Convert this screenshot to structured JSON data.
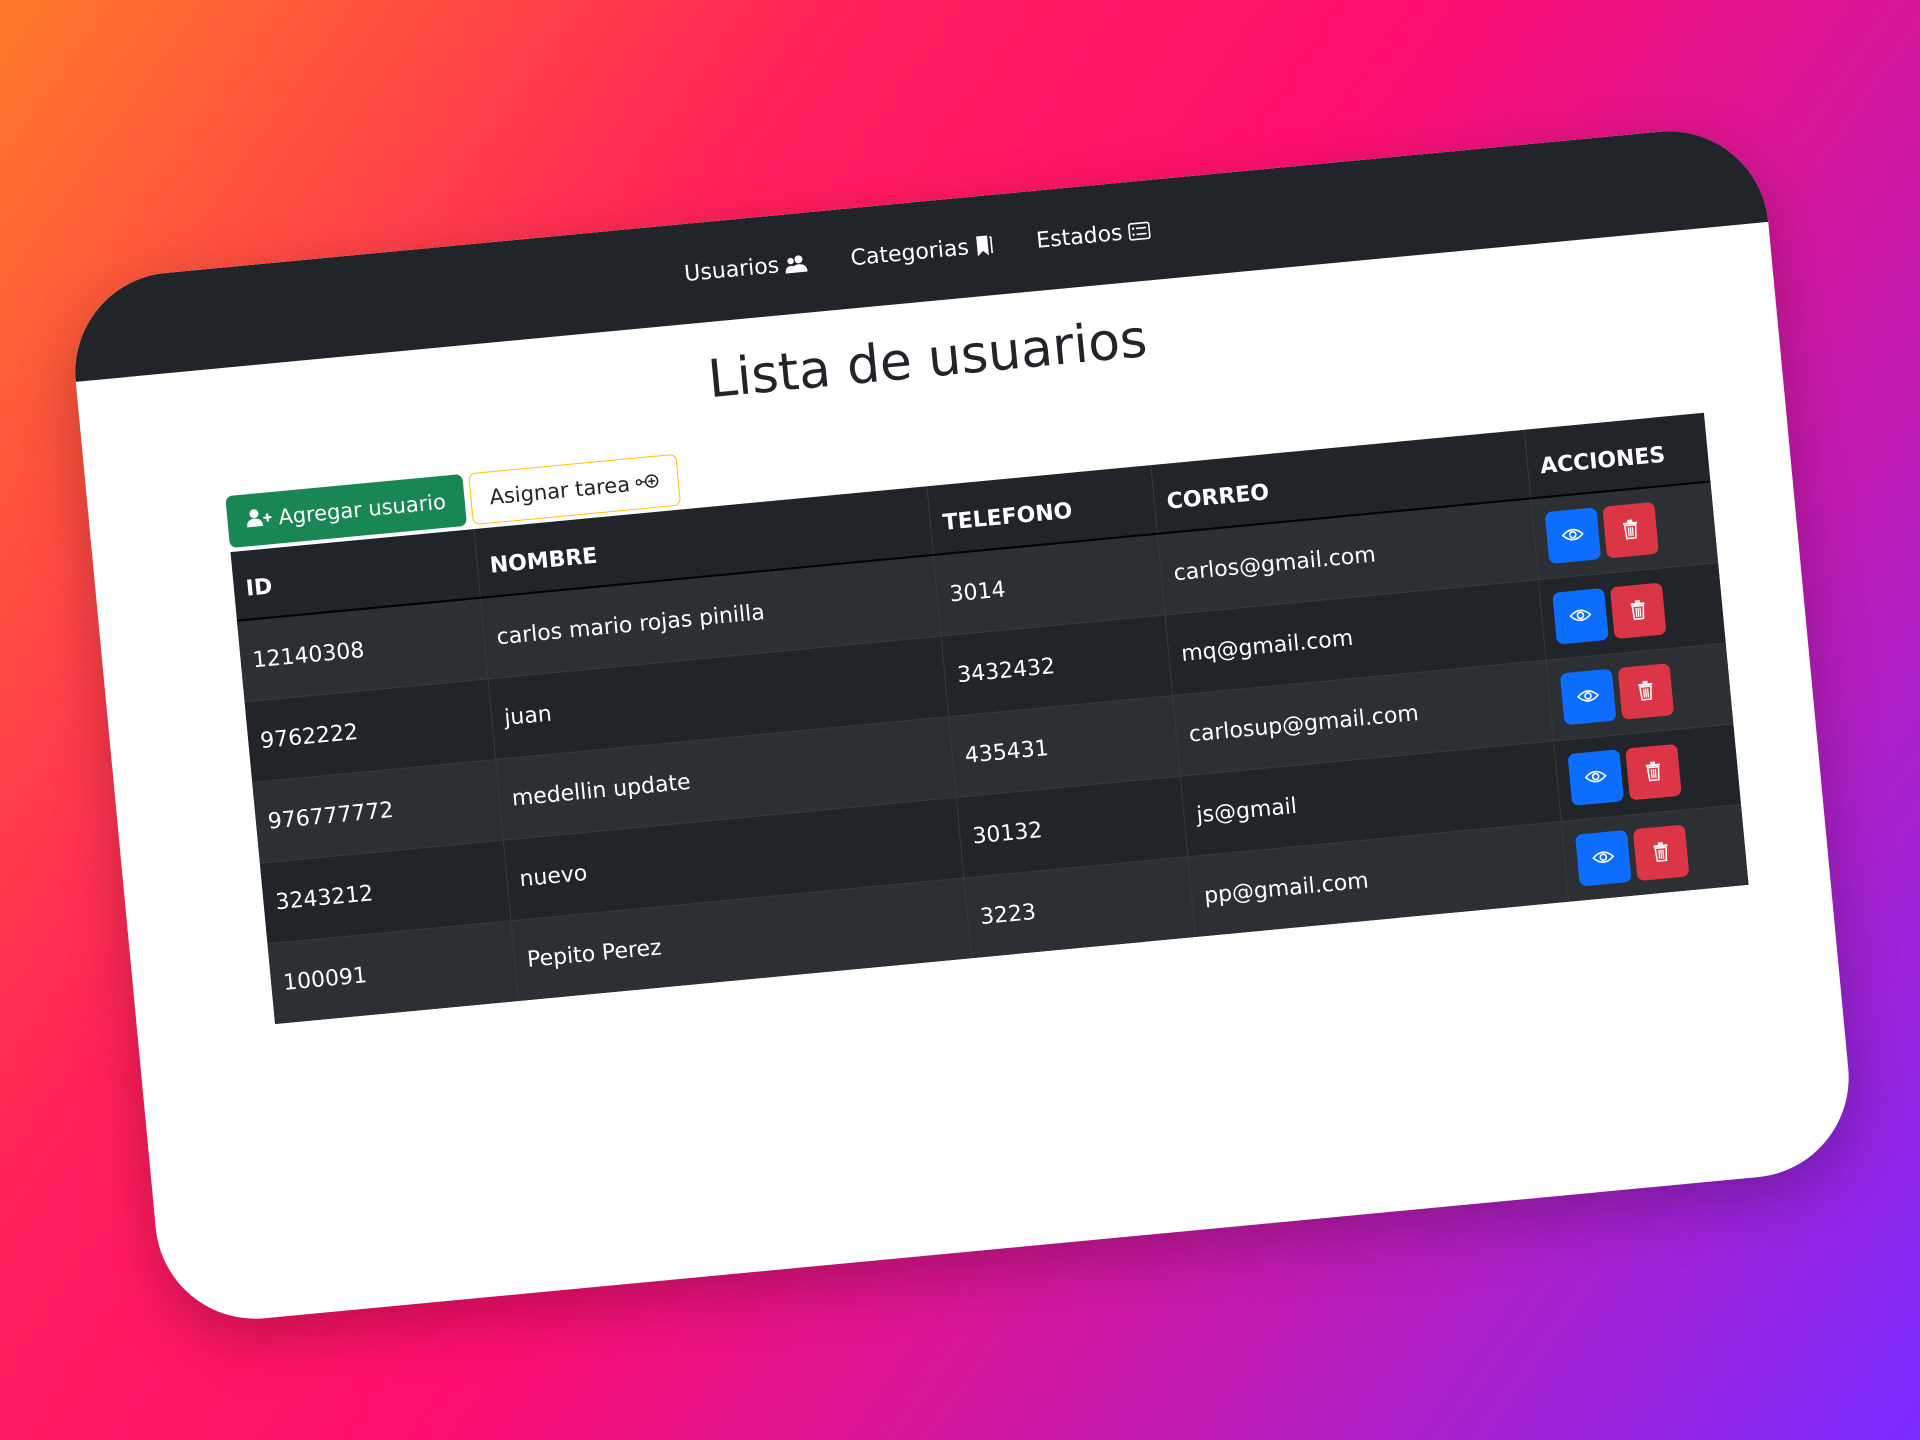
{
  "nav": {
    "items": [
      {
        "label": "Usuarios",
        "icon": "people-icon"
      },
      {
        "label": "Categorias",
        "icon": "bookmark-icon"
      },
      {
        "label": "Estados",
        "icon": "card-list-icon"
      }
    ]
  },
  "page": {
    "title": "Lista de usuarios"
  },
  "toolbar": {
    "add_user_label": "Agregar usuario",
    "assign_task_label": "Asignar tarea"
  },
  "table": {
    "headers": [
      "ID",
      "NOMBRE",
      "TELEFONO",
      "CORREO",
      "ACCIONES"
    ],
    "rows": [
      {
        "id": "12140308",
        "nombre": "carlos mario rojas pinilla",
        "telefono": "3014",
        "correo": "carlos@gmail.com"
      },
      {
        "id": "9762222",
        "nombre": "juan",
        "telefono": "3432432",
        "correo": "mq@gmail.com"
      },
      {
        "id": "976777772",
        "nombre": "medellin update",
        "telefono": "435431",
        "correo": "carlosup@gmail.com"
      },
      {
        "id": "3243212",
        "nombre": "nuevo",
        "telefono": "30132",
        "correo": "js@gmail"
      },
      {
        "id": "100091",
        "nombre": "Pepito Perez",
        "telefono": "3223",
        "correo": "pp@gmail.com"
      }
    ]
  },
  "colors": {
    "navbar": "#212529",
    "success": "#198754",
    "warning": "#ffc107",
    "primary": "#0d6efd",
    "danger": "#dc3545"
  }
}
